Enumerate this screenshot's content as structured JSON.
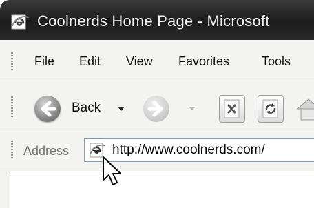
{
  "window": {
    "title": "Coolnerds Home Page - Microsoft",
    "title_icon": "ie-page-icon"
  },
  "menu": {
    "items": [
      {
        "label": "File"
      },
      {
        "label": "Edit"
      },
      {
        "label": "View"
      },
      {
        "label": "Favorites"
      },
      {
        "label": "Tools"
      }
    ]
  },
  "toolbar": {
    "back_label": "Back",
    "back_icon": "back-arrow-icon",
    "forward_icon": "forward-arrow-icon",
    "stop_icon": "stop-icon",
    "refresh_icon": "refresh-icon",
    "home_icon": "home-icon"
  },
  "address": {
    "label": "Address",
    "url": "http://www.coolnerds.com/",
    "icon": "ie-page-icon"
  },
  "cursor": {
    "icon": "mouse-pointer-icon"
  }
}
